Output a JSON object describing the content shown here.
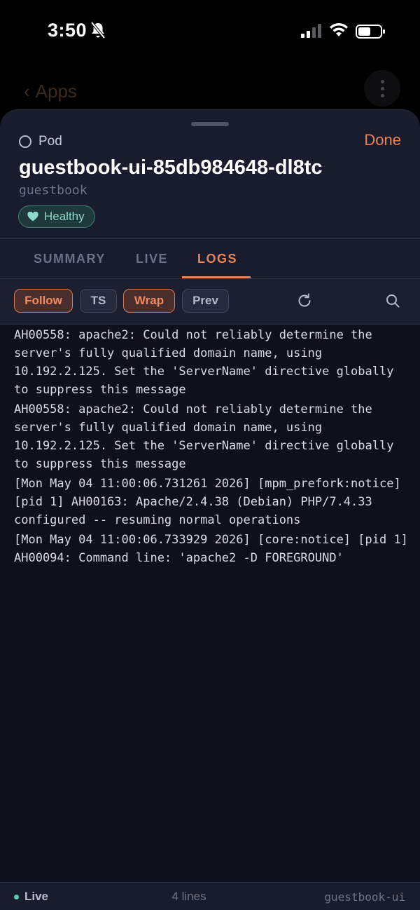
{
  "status_bar": {
    "time": "3:50",
    "icons": [
      "bell-slash-icon",
      "cellular-signal-icon",
      "wifi-icon",
      "battery-icon"
    ]
  },
  "background_nav": {
    "back_label": "Apps",
    "back_icon": "chevron-left-icon",
    "more_icon": "more-vertical-icon"
  },
  "sheet": {
    "kind_label": "Pod",
    "kind_icon": "circle-outline-icon",
    "done_label": "Done",
    "pod_name": "guestbook-ui-85db984648-dl8tc",
    "namespace": "guestbook",
    "health": {
      "label": "Healthy",
      "icon": "heart-icon",
      "color": "#8fd7c6"
    }
  },
  "tabs": [
    {
      "label": "SUMMARY",
      "active": false
    },
    {
      "label": "LIVE",
      "active": false
    },
    {
      "label": "LOGS",
      "active": true
    }
  ],
  "toolbar": {
    "buttons": [
      {
        "label": "Follow",
        "active": true
      },
      {
        "label": "TS",
        "active": false
      },
      {
        "label": "Wrap",
        "active": true
      },
      {
        "label": "Prev",
        "active": false
      }
    ],
    "refresh_icon": "refresh-icon",
    "search_icon": "search-icon"
  },
  "logs": [
    "AH00558: apache2: Could not reliably determine the server's fully qualified domain name, using 10.192.2.125. Set the 'ServerName' directive globally to suppress this message",
    "AH00558: apache2: Could not reliably determine the server's fully qualified domain name, using 10.192.2.125. Set the 'ServerName' directive globally to suppress this message",
    "[Mon May 04 11:00:06.731261 2026] [mpm_prefork:notice] [pid 1] AH00163: Apache/2.4.38 (Debian) PHP/7.4.33 configured -- resuming normal operations",
    "[Mon May 04 11:00:06.733929 2026] [core:notice] [pid 1] AH00094: Command line: 'apache2 -D FOREGROUND'"
  ],
  "footer": {
    "live_label": "Live",
    "line_count": "4 lines",
    "pod_short": "guestbook-ui"
  },
  "colors": {
    "accent": "#e8845c",
    "sheet_bg": "#181c2d",
    "log_bg": "#0e111b",
    "healthy": "#57c7b0"
  }
}
